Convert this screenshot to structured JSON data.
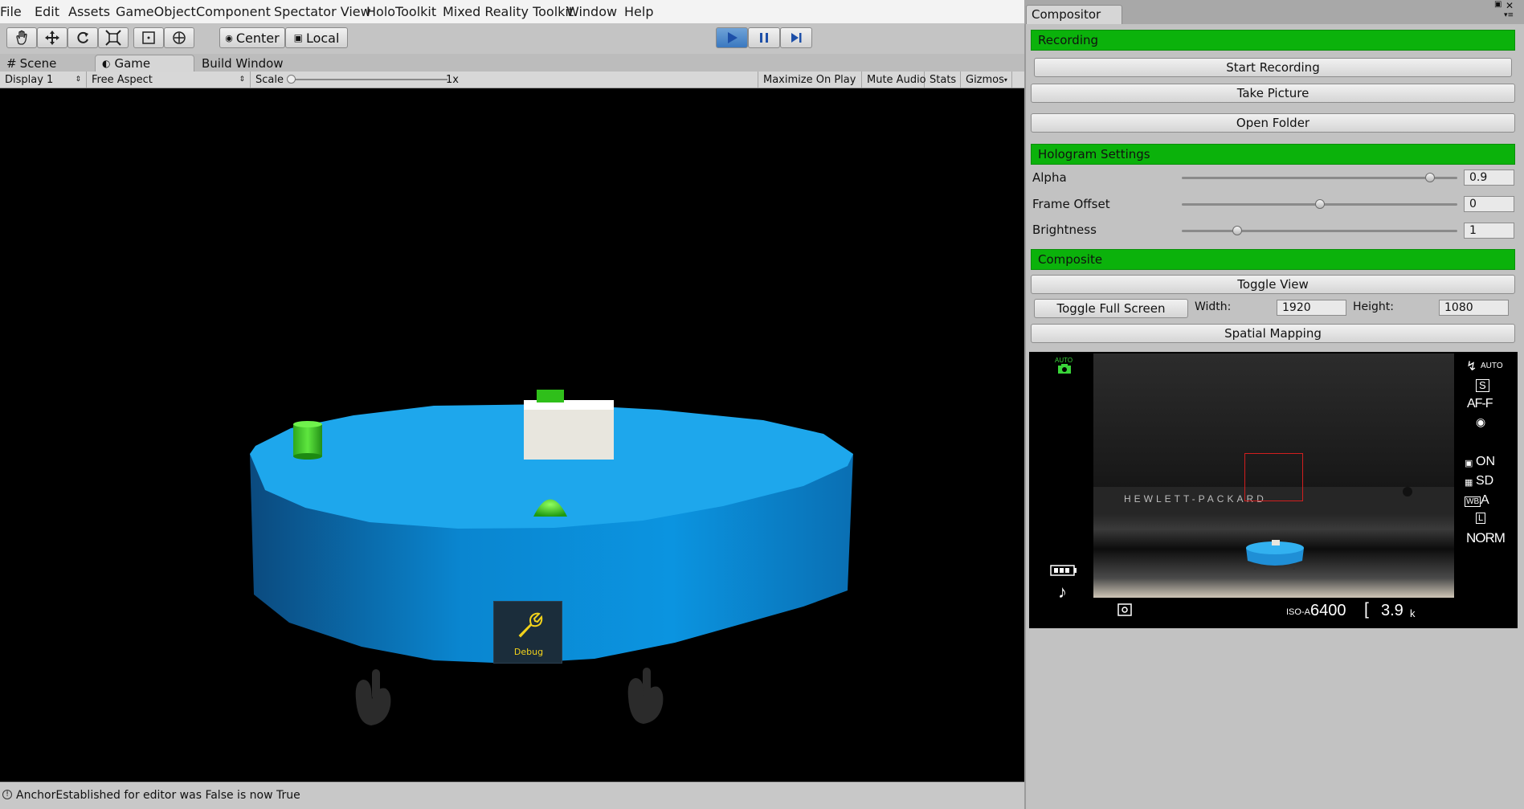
{
  "menu": [
    "File",
    "Edit",
    "Assets",
    "GameObject",
    "Component",
    "Spectator View",
    "HoloToolkit",
    "Mixed Reality Toolkit",
    "Window",
    "Help"
  ],
  "toolbar": {
    "pivot_label": "Center",
    "space_label": "Local",
    "play_active": true
  },
  "tabs": {
    "scene": "Scene",
    "game": "Game",
    "build": "Build Window"
  },
  "gamebar": {
    "display": "Display 1",
    "aspect": "Free Aspect",
    "scale_label": "Scale",
    "scale_value": "1x",
    "maximize": "Maximize On Play",
    "mute": "Mute Audio",
    "stats": "Stats",
    "gizmos": "Gizmos"
  },
  "scene": {
    "debug_label": "Debug"
  },
  "status": {
    "message": "AnchorEstablished for editor was False is now True"
  },
  "compositor": {
    "title": "Compositor",
    "recording": {
      "header": "Recording",
      "start": "Start Recording",
      "picture": "Take Picture",
      "folder": "Open Folder"
    },
    "hologram": {
      "header": "Hologram Settings",
      "alpha_label": "Alpha",
      "alpha_value": "0.9",
      "alpha_fraction": 0.9,
      "offset_label": "Frame Offset",
      "offset_value": "0",
      "offset_fraction": 0.5,
      "brightness_label": "Brightness",
      "brightness_value": "1",
      "brightness_fraction": 0.2
    },
    "composite": {
      "header": "Composite",
      "toggle_view": "Toggle View",
      "toggle_full": "Toggle Full Screen",
      "width_label": "Width:",
      "width_value": "1920",
      "height_label": "Height:",
      "height_value": "1080",
      "spatial": "Spatial Mapping"
    },
    "camera": {
      "brand_text": "HEWLETT-PACKARD",
      "auto_top": "AUTO",
      "flash": "AUTO",
      "s_mode": "S",
      "af": "AF-F",
      "on": "ON",
      "sd": "SD",
      "wb": "A",
      "norm": "NORM",
      "iso_prefix": "ISO-A",
      "iso": "6400",
      "shots": "3.9",
      "shots_unit": "k"
    }
  }
}
